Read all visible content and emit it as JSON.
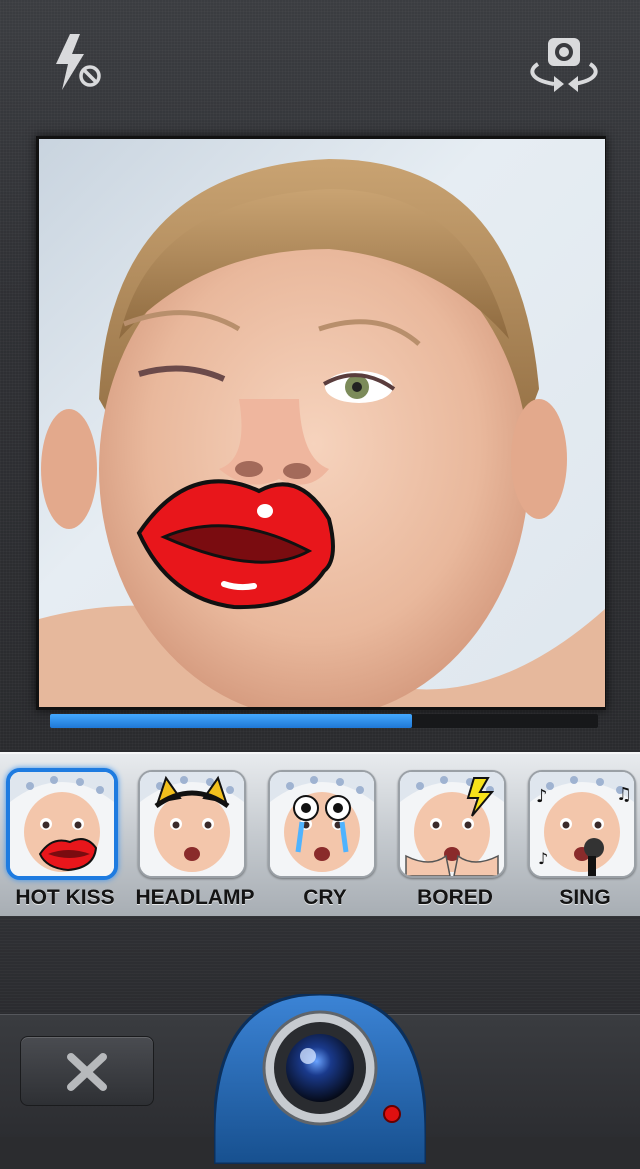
{
  "top_bar": {
    "flash_icon": "flash-off-icon",
    "switch_camera_icon": "camera-switch-icon"
  },
  "preview": {
    "overlay_sticker": "lips-sticker",
    "progress": 0.66
  },
  "effects": [
    {
      "label": "HOT KISS",
      "icon": "kiss-lips",
      "selected": true
    },
    {
      "label": "HEADLAMP",
      "icon": "cat-ears"
    },
    {
      "label": "CRY",
      "icon": "crying-eyes"
    },
    {
      "label": "BORED",
      "icon": "lightning-hands"
    },
    {
      "label": "SING",
      "icon": "microphone-notes"
    }
  ],
  "toolbar": {
    "cancel_icon": "close-icon",
    "shutter_icon": "camera-lens-icon"
  },
  "colors": {
    "accent": "#1e7be0",
    "progress": "#2f8ff0",
    "lips": "#e8161b"
  }
}
